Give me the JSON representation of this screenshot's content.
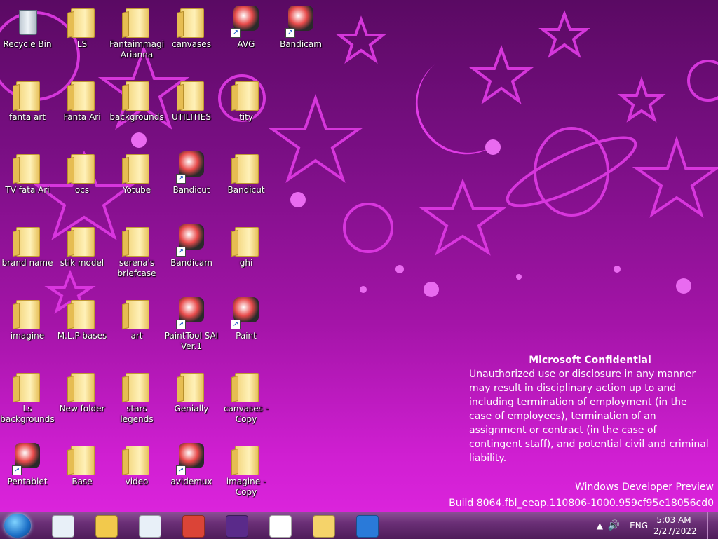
{
  "desktop": {
    "icons": [
      {
        "label": "Recycle Bin",
        "type": "recycle"
      },
      {
        "label": "LS",
        "type": "folder"
      },
      {
        "label": "Fantaimmagi Arianna",
        "type": "folder"
      },
      {
        "label": "canvases",
        "type": "folder"
      },
      {
        "label": "AVG",
        "type": "app"
      },
      {
        "label": "Bandicam",
        "type": "app"
      },
      {
        "label": "fanta art",
        "type": "folder"
      },
      {
        "label": "Fanta Ari",
        "type": "folder"
      },
      {
        "label": "backgrounds",
        "type": "folder"
      },
      {
        "label": "UTILITIES",
        "type": "folder"
      },
      {
        "label": "tity",
        "type": "folder"
      },
      {
        "label": "TV fata Ari",
        "type": "folder"
      },
      {
        "label": "ocs",
        "type": "folder"
      },
      {
        "label": "Yotube",
        "type": "folder"
      },
      {
        "label": "Bandicut",
        "type": "app"
      },
      {
        "label": "Bandicut",
        "type": "folder"
      },
      {
        "label": "brand name",
        "type": "folder"
      },
      {
        "label": "stik model",
        "type": "folder"
      },
      {
        "label": "serena's briefcase",
        "type": "folder"
      },
      {
        "label": "Bandicam",
        "type": "app"
      },
      {
        "label": "ghi",
        "type": "folder"
      },
      {
        "label": "imagine",
        "type": "folder"
      },
      {
        "label": "M.L.P bases",
        "type": "folder"
      },
      {
        "label": "art",
        "type": "folder"
      },
      {
        "label": "PaintTool SAI Ver.1",
        "type": "app"
      },
      {
        "label": "Paint",
        "type": "app"
      },
      {
        "label": "Ls backgrounds",
        "type": "folder"
      },
      {
        "label": "New folder",
        "type": "folder"
      },
      {
        "label": "stars legends",
        "type": "folder"
      },
      {
        "label": "Genially",
        "type": "folder"
      },
      {
        "label": "canvases - Copy",
        "type": "folder"
      },
      {
        "label": "Pentablet",
        "type": "app"
      },
      {
        "label": "Base",
        "type": "folder"
      },
      {
        "label": "video",
        "type": "folder"
      },
      {
        "label": "avidemux",
        "type": "app"
      },
      {
        "label": "imagine - Copy",
        "type": "folder"
      }
    ]
  },
  "watermark": {
    "title": "Microsoft Confidential",
    "body": "Unauthorized use or disclosure in any manner may result in disciplinary action up to and including termination of employment (in the case of employees), termination of an assignment or contract (in the case of contingent staff), and potential civil and criminal liability.",
    "edition": "Windows Developer Preview",
    "build": "Build 8064.fbl_eeap.110806-1000.959cf95e18056cd0"
  },
  "taskbar": {
    "language": "ENG",
    "time": "5:03 AM",
    "date": "2/27/2022",
    "app_colors": [
      "#e8f0f8",
      "#f2c94c",
      "#e8f0f8",
      "#db4437",
      "#5a2a8a",
      "#ffffff",
      "#f5d36a",
      "#2a7ad9"
    ]
  }
}
